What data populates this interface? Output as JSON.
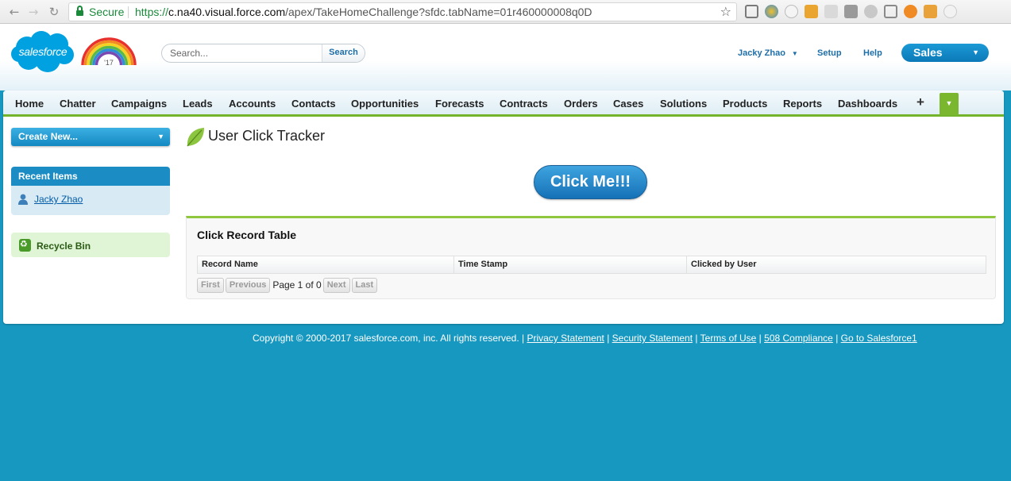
{
  "browser": {
    "secure_label": "Secure",
    "url_scheme": "https://",
    "url_host": "c.na40.visual.force.com",
    "url_path": "/apex/TakeHomeChallenge?sfdc.tabName=01r460000008q0D",
    "back_icon": "back-arrow-icon",
    "forward_icon": "forward-arrow-icon",
    "reload_icon": "reload-icon",
    "bookmark_icon": "star-icon",
    "secure_color": "#1a8a3a"
  },
  "header": {
    "logo_text": "salesforce",
    "logo_badge": "'17",
    "search_placeholder": "Search...",
    "search_button": "Search",
    "user_name": "Jacky Zhao",
    "setup": "Setup",
    "help": "Help",
    "app_name": "Sales",
    "brand_color": "#00a1e0"
  },
  "tabs": [
    {
      "label": "Home"
    },
    {
      "label": "Chatter"
    },
    {
      "label": "Campaigns"
    },
    {
      "label": "Leads"
    },
    {
      "label": "Accounts"
    },
    {
      "label": "Contacts"
    },
    {
      "label": "Opportunities"
    },
    {
      "label": "Forecasts"
    },
    {
      "label": "Contracts"
    },
    {
      "label": "Orders"
    },
    {
      "label": "Cases"
    },
    {
      "label": "Solutions"
    },
    {
      "label": "Products"
    },
    {
      "label": "Reports"
    },
    {
      "label": "Dashboards"
    }
  ],
  "tab_plus": "+",
  "sidebar": {
    "create_new": "Create New...",
    "recent_items_title": "Recent Items",
    "recent_items": [
      {
        "label": "Jacky Zhao"
      }
    ],
    "recycle_bin": "Recycle Bin"
  },
  "main": {
    "page_title": "User Click Tracker",
    "click_button": "Click Me!!!",
    "table_title": "Click Record Table",
    "columns": [
      "Record Name",
      "Time Stamp",
      "Clicked by User"
    ],
    "pager": {
      "first": "First",
      "previous": "Previous",
      "page_text": "Page 1 of 0",
      "next": "Next",
      "last": "Last"
    }
  },
  "footer": {
    "copyright": "Copyright © 2000-2017 salesforce.com, inc. All rights reserved. |",
    "links": [
      "Privacy Statement",
      "Security Statement",
      "Terms of Use",
      "508 Compliance",
      "Go to Salesforce1"
    ],
    "separator": "|"
  }
}
